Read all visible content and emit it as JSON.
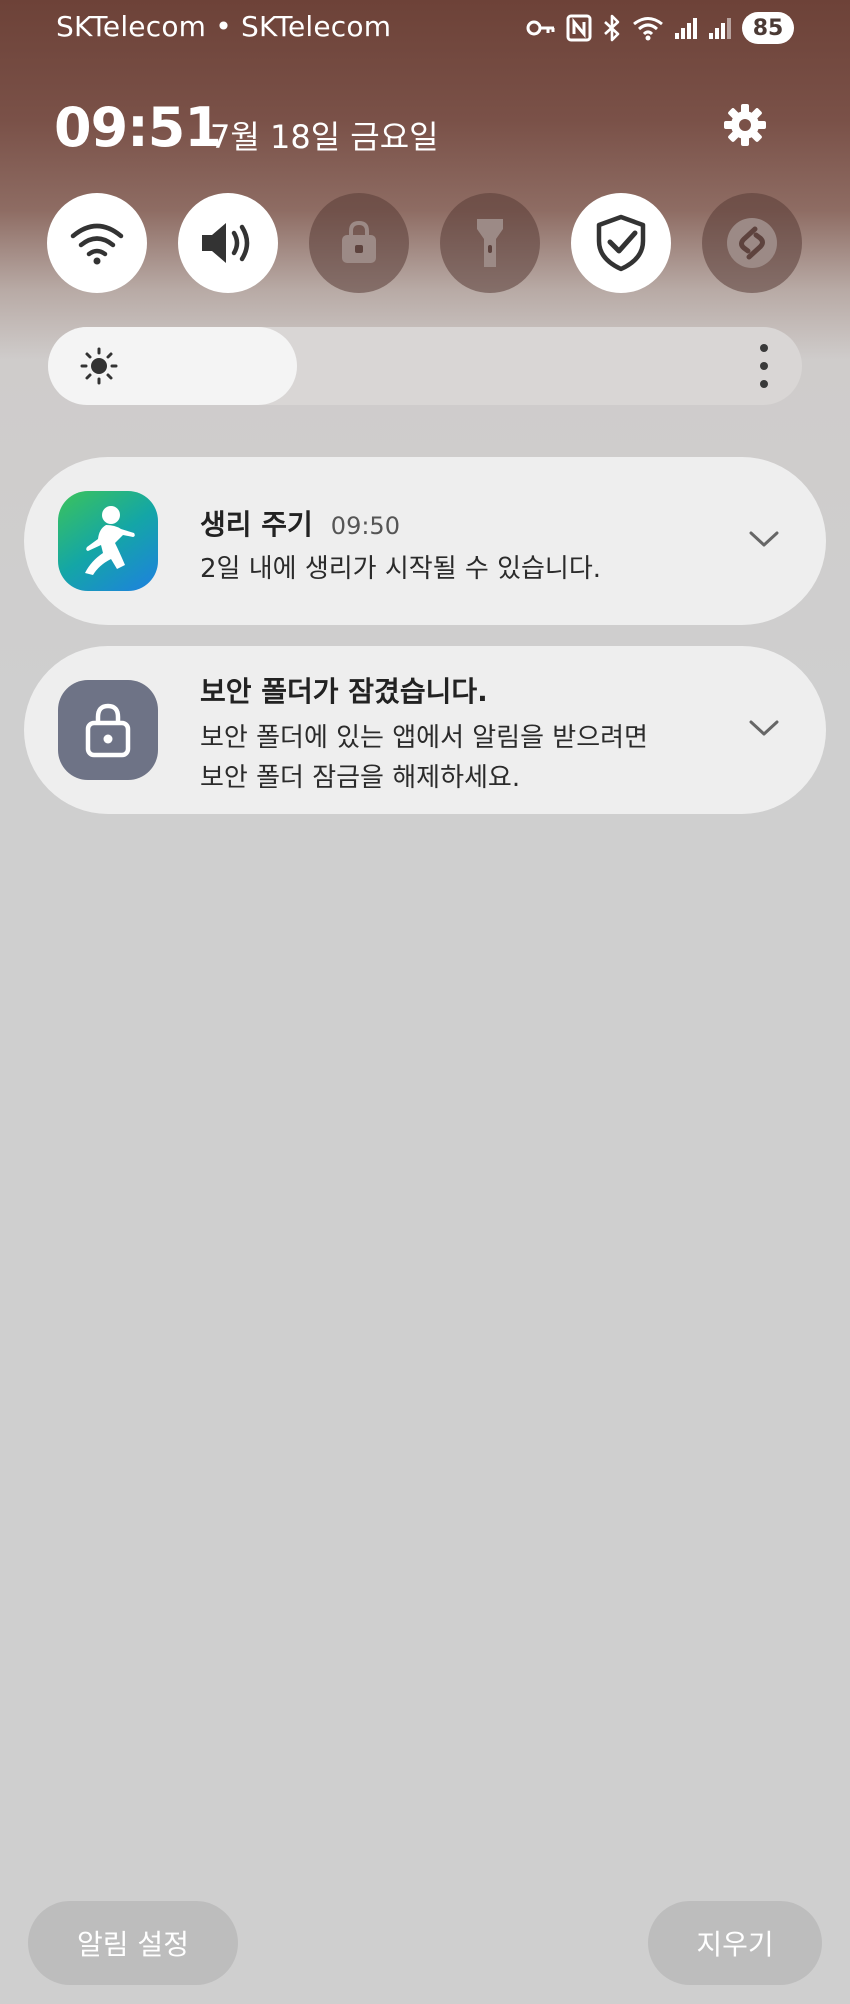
{
  "status_bar": {
    "carrier": "SKTelecom • SKTelecom",
    "icons": [
      "key-icon",
      "nfc-icon",
      "bluetooth-icon",
      "wifi-call-icon",
      "signal-icon",
      "signal-icon-2"
    ],
    "battery": "85"
  },
  "header": {
    "time": "09:51",
    "date": "7월 18일 금요일",
    "settings_icon": "gear-icon"
  },
  "quick_settings": [
    {
      "icon": "wifi-icon",
      "state": "on"
    },
    {
      "icon": "sound-icon",
      "state": "on"
    },
    {
      "icon": "secure-folder-icon",
      "state": "off"
    },
    {
      "icon": "flashlight-icon",
      "state": "off"
    },
    {
      "icon": "shield-check-icon",
      "state": "on"
    },
    {
      "icon": "shazam-icon",
      "state": "off"
    }
  ],
  "brightness": {
    "level": 0.33,
    "icon": "sun-icon",
    "more_icon": "more-vertical-icon"
  },
  "notifications": [
    {
      "app_icon": "samsung-health-icon",
      "title": "생리 주기",
      "time": "09:50",
      "body": "2일 내에 생리가 시작될 수 있습니다."
    },
    {
      "app_icon": "lock-icon",
      "title": "보안 폴더가 잠겼습니다.",
      "body_line1": "보안 폴더에 있는 앱에서 알림을 받으려면",
      "body_line2": "보안 폴더 잠금을 해제하세요."
    }
  ],
  "footer": {
    "notification_settings_label": "알림 설정",
    "clear_label": "지우기"
  },
  "colors": {
    "header_bg": "#6d4238",
    "panel_bg": "#cfcfcf",
    "toggle_on": "#ffffff",
    "toggle_off": "#5a3c37",
    "notif_bg": "#eeeeee",
    "health_icon_start": "#38b34a",
    "health_icon_end": "#1e88e5",
    "lock_icon_bg": "#6e7386"
  }
}
